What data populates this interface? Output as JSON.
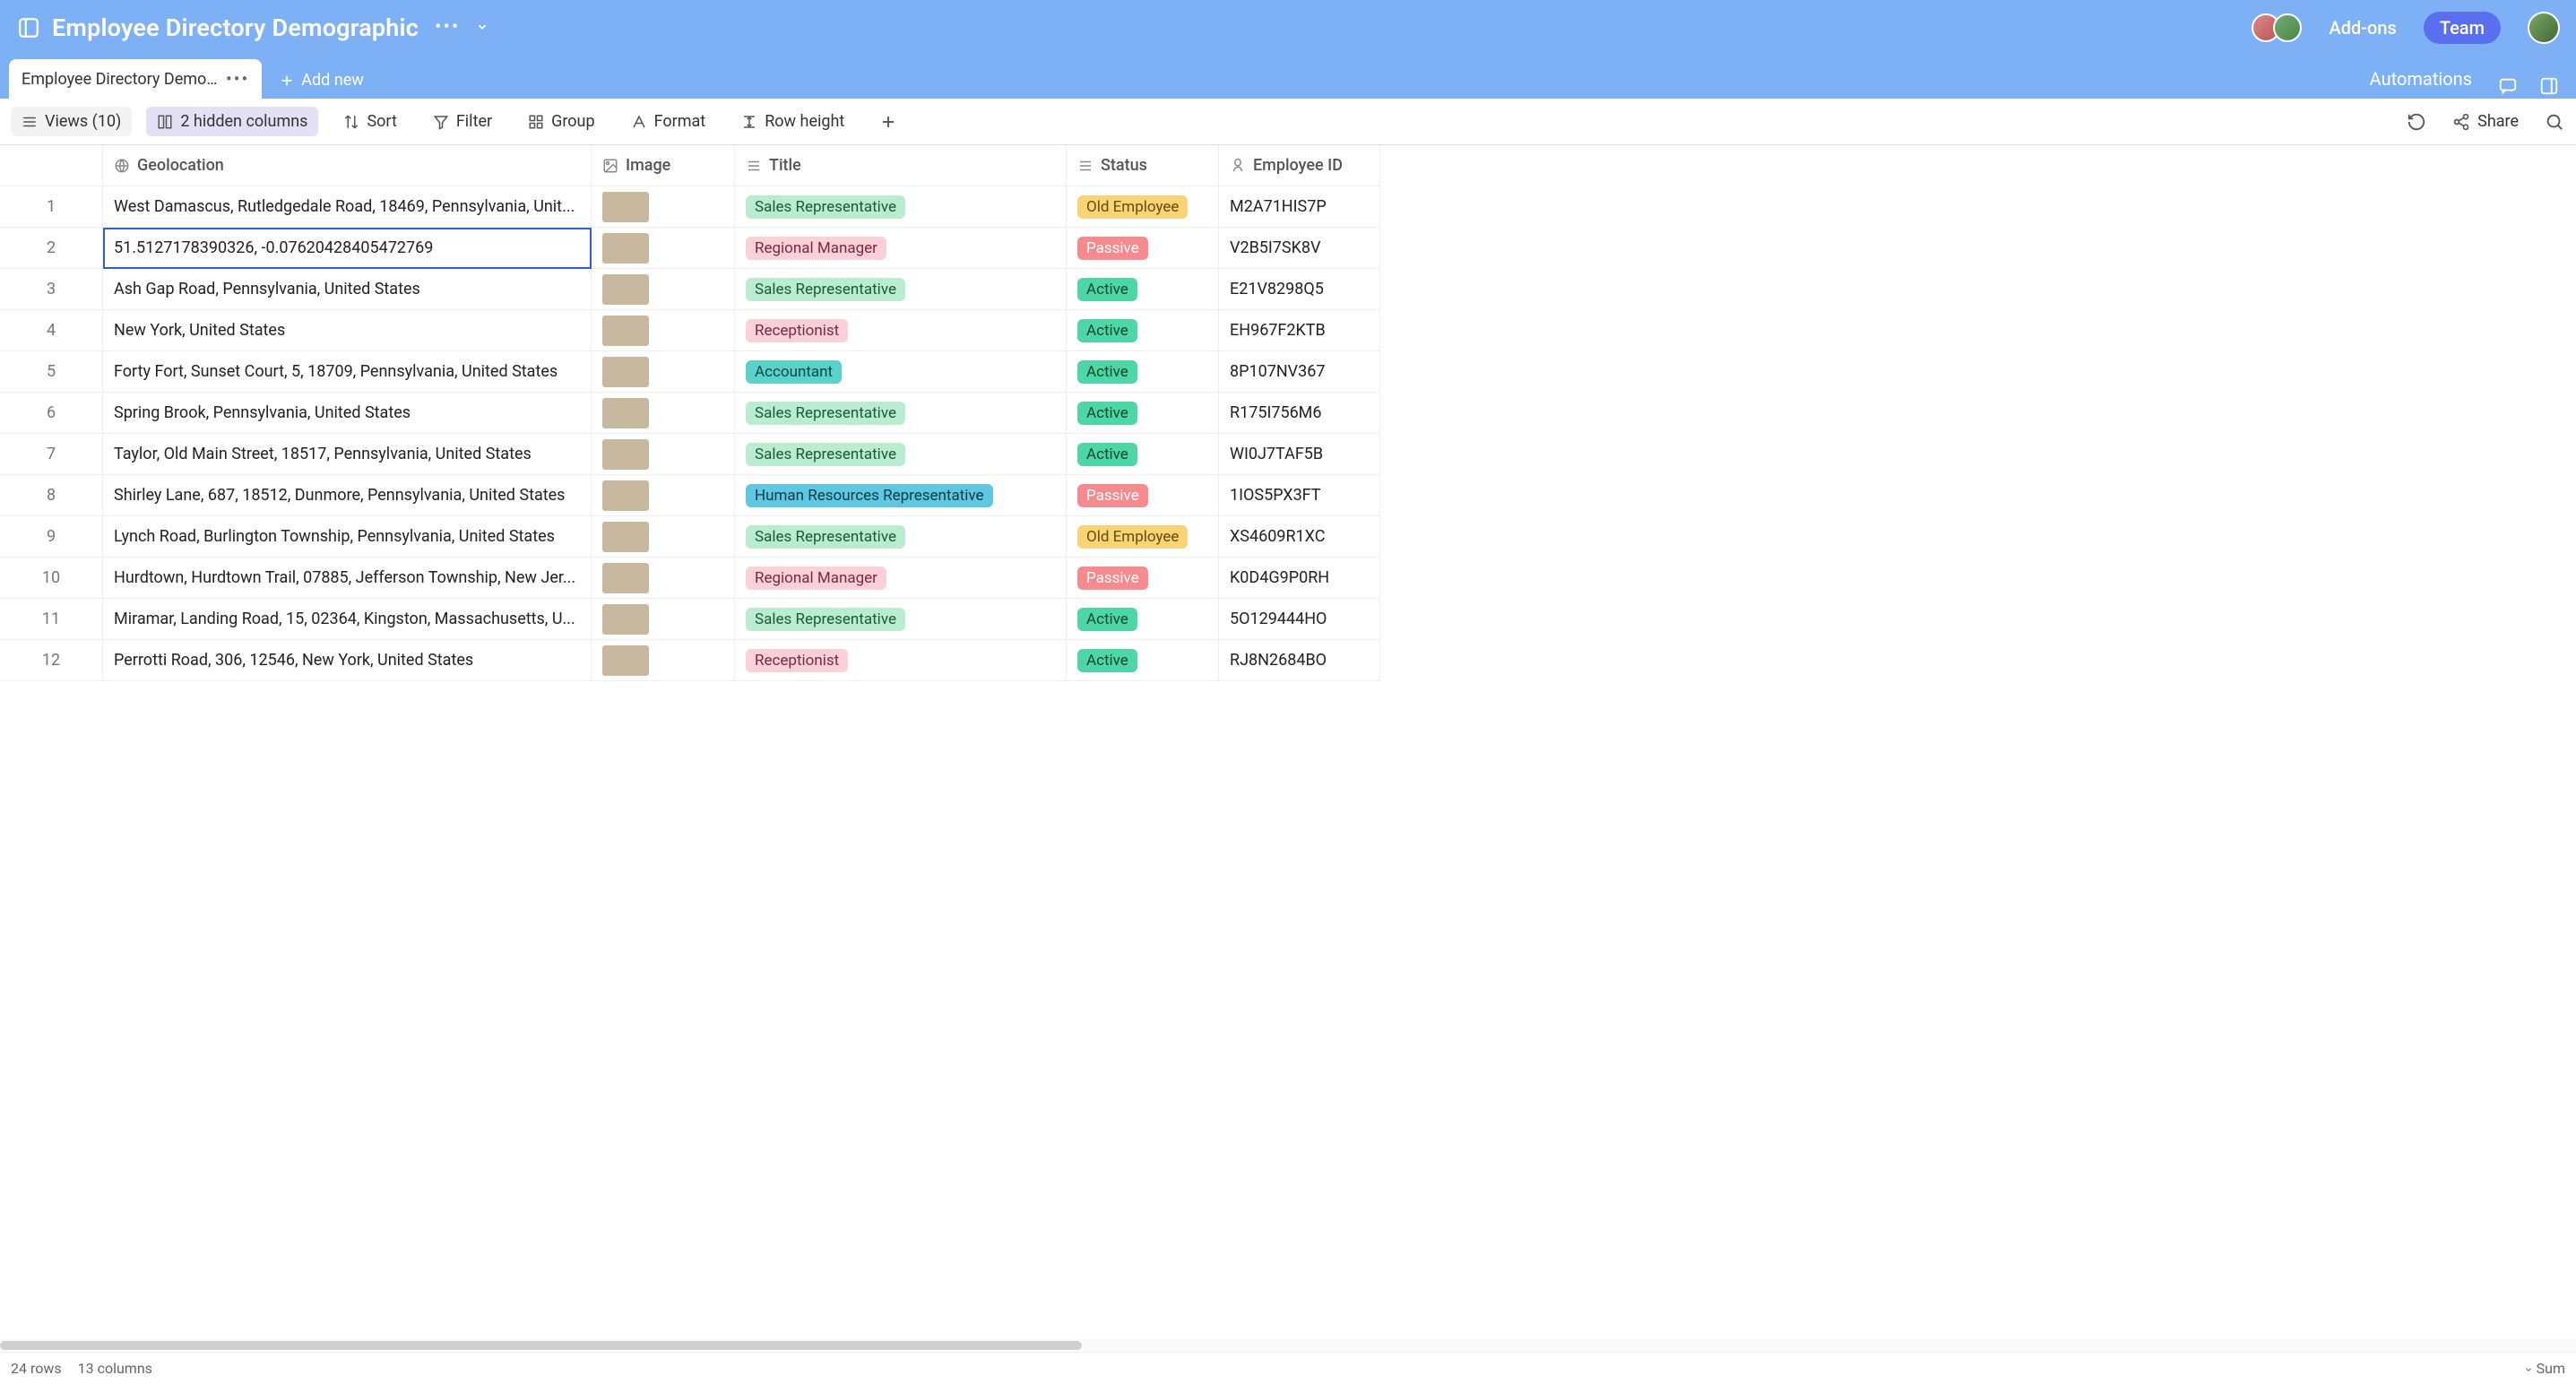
{
  "topbar": {
    "title": "Employee Directory Demographic",
    "addons": "Add-ons",
    "team": "Team"
  },
  "tabbar": {
    "tab_name": "Employee Directory Demog...",
    "add_new": "Add new",
    "automations": "Automations"
  },
  "toolbar": {
    "views": "Views (10)",
    "hidden": "2 hidden columns",
    "sort": "Sort",
    "filter": "Filter",
    "group": "Group",
    "format": "Format",
    "rowheight": "Row height",
    "share": "Share"
  },
  "columns": {
    "geolocation": "Geolocation",
    "image": "Image",
    "title": "Title",
    "status": "Status",
    "employee_id": "Employee ID"
  },
  "rows": [
    {
      "n": "1",
      "geo": "West Damascus, Rutledgedale Road, 18469, Pennsylvania, Unit...",
      "title": "Sales Representative",
      "title_cls": "p-green",
      "status": "Old Employee",
      "status_cls": "p-yellow",
      "eid": "M2A71HIS7P"
    },
    {
      "n": "2",
      "geo": "51.5127178390326, -0.07620428405472769",
      "title": "Regional Manager",
      "title_cls": "p-pink",
      "status": "Passive",
      "status_cls": "p-red",
      "eid": "V2B5I7SK8V",
      "selected": true
    },
    {
      "n": "3",
      "geo": "Ash Gap Road, Pennsylvania, United States",
      "title": "Sales Representative",
      "title_cls": "p-green",
      "status": "Active",
      "status_cls": "p-green2",
      "eid": "E21V8298Q5"
    },
    {
      "n": "4",
      "geo": "New York, United States",
      "title": "Receptionist",
      "title_cls": "p-pink",
      "status": "Active",
      "status_cls": "p-green2",
      "eid": "EH967F2KTB"
    },
    {
      "n": "5",
      "geo": "Forty Fort, Sunset Court, 5, 18709, Pennsylvania, United States",
      "title": "Accountant",
      "title_cls": "p-teal",
      "status": "Active",
      "status_cls": "p-green2",
      "eid": "8P107NV367"
    },
    {
      "n": "6",
      "geo": "Spring Brook, Pennsylvania, United States",
      "title": "Sales Representative",
      "title_cls": "p-green",
      "status": "Active",
      "status_cls": "p-green2",
      "eid": "R175I756M6"
    },
    {
      "n": "7",
      "geo": "Taylor, Old Main Street, 18517, Pennsylvania, United States",
      "title": "Sales Representative",
      "title_cls": "p-green",
      "status": "Active",
      "status_cls": "p-green2",
      "eid": "WI0J7TAF5B"
    },
    {
      "n": "8",
      "geo": "Shirley Lane, 687, 18512, Dunmore, Pennsylvania, United States",
      "title": "Human Resources Representative",
      "title_cls": "p-hr",
      "status": "Passive",
      "status_cls": "p-red",
      "eid": "1IOS5PX3FT"
    },
    {
      "n": "9",
      "geo": "Lynch Road, Burlington Township, Pennsylvania, United States",
      "title": "Sales Representative",
      "title_cls": "p-green",
      "status": "Old Employee",
      "status_cls": "p-yellow",
      "eid": "XS4609R1XC"
    },
    {
      "n": "10",
      "geo": "Hurdtown, Hurdtown Trail, 07885, Jefferson Township, New Jer...",
      "title": "Regional Manager",
      "title_cls": "p-pink",
      "status": "Passive",
      "status_cls": "p-red",
      "eid": "K0D4G9P0RH"
    },
    {
      "n": "11",
      "geo": "Miramar, Landing Road, 15, 02364, Kingston, Massachusetts, U...",
      "title": "Sales Representative",
      "title_cls": "p-green",
      "status": "Active",
      "status_cls": "p-green2",
      "eid": "5O129444HO"
    },
    {
      "n": "12",
      "geo": "Perrotti Road, 306, 12546, New York, United States",
      "title": "Receptionist",
      "title_cls": "p-pink",
      "status": "Active",
      "status_cls": "p-green2",
      "eid": "RJ8N2684BO"
    }
  ],
  "footer": {
    "rows": "24 rows",
    "cols": "13 columns",
    "sum": "Sum"
  }
}
